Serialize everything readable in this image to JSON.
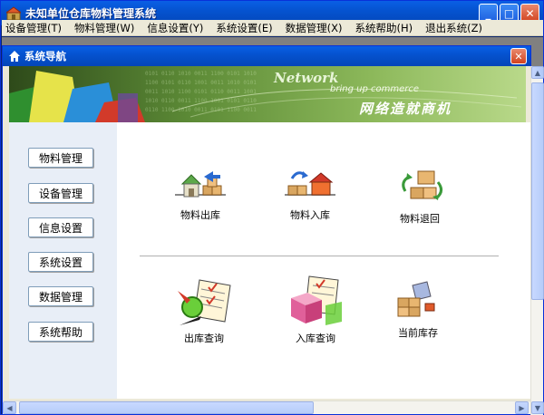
{
  "window": {
    "title": "未知单位仓库物料管理系统",
    "minimize_glyph": "_",
    "maximize_glyph": "□",
    "close_glyph": "✕"
  },
  "menu": [
    "设备管理(T)",
    "物料管理(W)",
    "信息设置(Y)",
    "系统设置(E)",
    "数据管理(X)",
    "系统帮助(H)",
    "退出系统(Z)"
  ],
  "child_window": {
    "title": "系统导航",
    "close_glyph": "✕"
  },
  "banner": {
    "word": "Network",
    "slogan": "bring up commerce",
    "chinese": "网络造就商机"
  },
  "nav_buttons": [
    "物料管理",
    "设备管理",
    "信息设置",
    "系统设置",
    "数据管理",
    "系统帮助"
  ],
  "tiles": {
    "row1": [
      "物料出库",
      "物料入库",
      "物料退回"
    ],
    "row2": [
      "出库查询",
      "入库查询",
      "当前库存"
    ]
  },
  "scroll": {
    "up": "▲",
    "down": "▼",
    "left": "◀",
    "right": "▶"
  },
  "colors": {
    "title_blue": "#0553D0",
    "banner_green": "#4C7A2A"
  }
}
